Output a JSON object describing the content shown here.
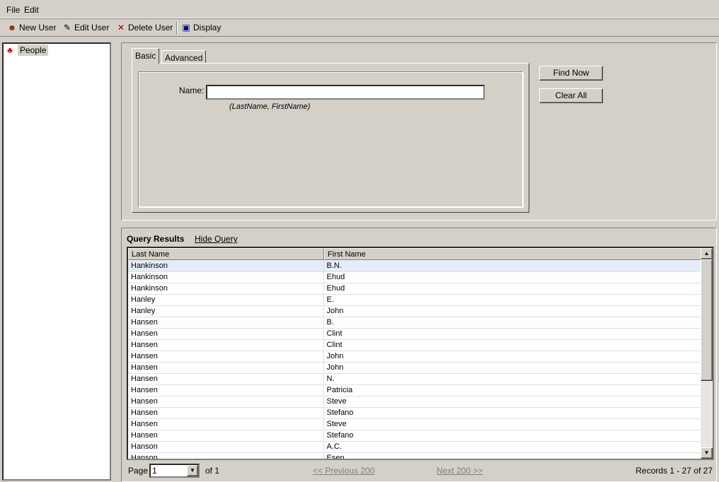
{
  "menu": {
    "file": "File",
    "edit": "Edit"
  },
  "toolbar": {
    "new_user": "New User",
    "edit_user": "Edit User",
    "delete_user": "Delete User",
    "display": "Display"
  },
  "tree": {
    "root": "People"
  },
  "query": {
    "tabs": [
      {
        "label": "Basic",
        "active": true
      },
      {
        "label": "Advanced",
        "active": false
      }
    ],
    "name_label": "Name:",
    "name_value": "",
    "name_hint": "(LastName, FirstName)",
    "find_now": "Find Now",
    "clear_all": "Clear All"
  },
  "results": {
    "title": "Query Results",
    "hide_query": "Hide Query",
    "columns": [
      "Last Name",
      "First Name"
    ],
    "rows": [
      [
        "Hankinson",
        "B.N."
      ],
      [
        "Hankinson",
        "Ehud"
      ],
      [
        "Hankinson",
        "Ehud"
      ],
      [
        "Hanley",
        "E."
      ],
      [
        "Hanley",
        "John"
      ],
      [
        "Hansen",
        "B."
      ],
      [
        "Hansen",
        "Clint"
      ],
      [
        "Hansen",
        "Clint"
      ],
      [
        "Hansen",
        "John"
      ],
      [
        "Hansen",
        "John"
      ],
      [
        "Hansen",
        "N."
      ],
      [
        "Hansen",
        "Patricia"
      ],
      [
        "Hansen",
        "Steve"
      ],
      [
        "Hansen",
        "Stefano"
      ],
      [
        "Hansen",
        "Steve"
      ],
      [
        "Hansen",
        "Stefano"
      ],
      [
        "Hanson",
        "A.C."
      ],
      [
        "Hanson",
        "Esen"
      ]
    ],
    "selected_row": 0
  },
  "footer": {
    "page_label": "Page",
    "page_value": "1",
    "of": "of 1",
    "previous": "<< Previous 200",
    "next": "Next 200 >>",
    "records": "Records 1 - 27 of 27"
  }
}
